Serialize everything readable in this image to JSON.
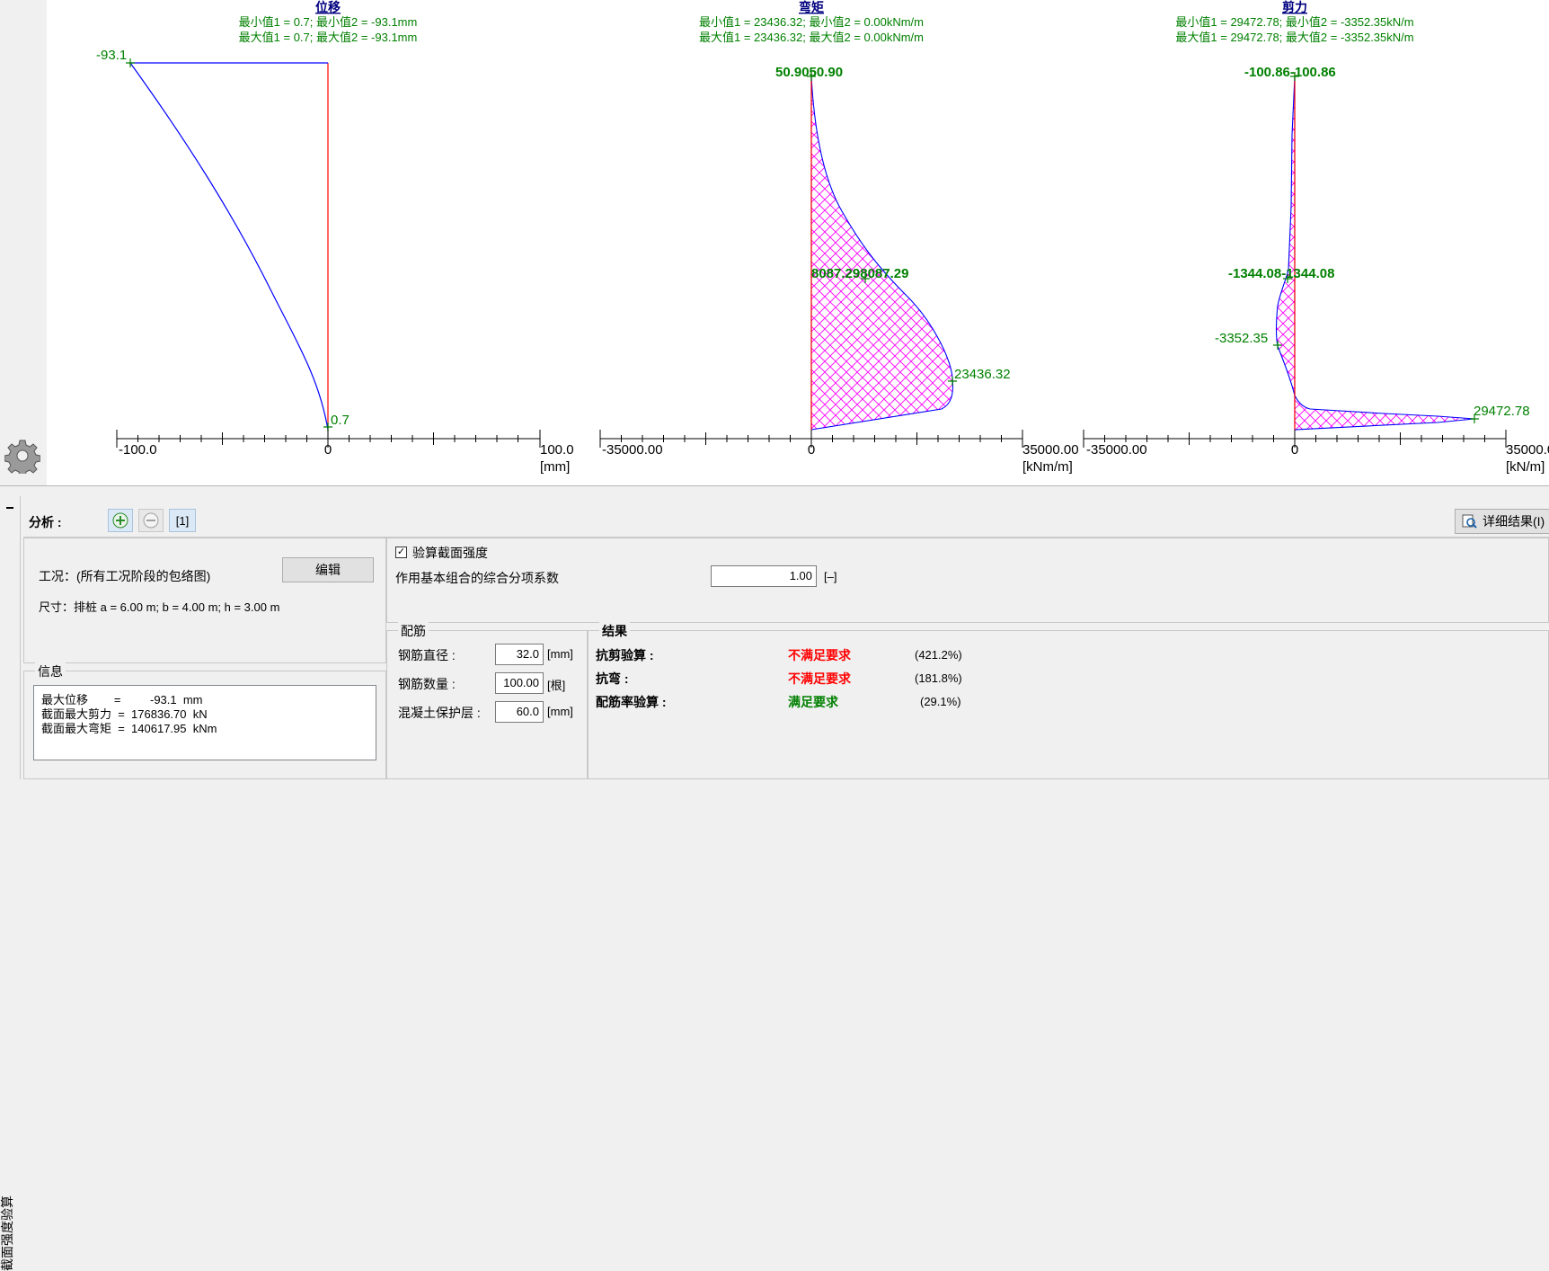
{
  "charts": {
    "displacement": {
      "title": "位移",
      "line1": "最小值1 = 0.7; 最小值2 = -93.1mm",
      "line2": "最大值1 = 0.7; 最大值2 = -93.1mm",
      "top_value": "-93.1",
      "bottom_value": "0.7",
      "axis_min": "-100.0",
      "axis_zero": "0",
      "axis_max": "100.0",
      "unit": "[mm]"
    },
    "moment": {
      "title": "弯矩",
      "line1": "最小值1 = 23436.32; 最小值2 = 0.00kNm/m",
      "line2": "最大值1 = 23436.32; 最大值2 = 0.00kNm/m",
      "top_value": "50.9050.90",
      "mid_value": "8087.298087.29",
      "peak_value": "23436.32",
      "axis_min": "-35000.00",
      "axis_zero": "0",
      "axis_max": "35000.00",
      "unit": "[kNm/m]"
    },
    "shear": {
      "title": "剪力",
      "line1": "最小值1 = 29472.78; 最小值2 = -3352.35kN/m",
      "line2": "最大值1 = 29472.78; 最大值2 = -3352.35kN/m",
      "top_value": "-100.86-100.86",
      "mid_value": "-1344.08-1344.08",
      "min_value": "-3352.35",
      "peak_value": "29472.78",
      "axis_min": "-35000.00",
      "axis_zero": "0",
      "axis_max": "35000.0",
      "unit": "[kN/m]"
    },
    "colors": {
      "curve": "#0000ff",
      "axis_red": "#ff0000",
      "label_green": "#008000",
      "title_blue": "#000080",
      "hatch": "#ff00ff"
    }
  },
  "analysis": {
    "label": "分析 :",
    "stage_tab": "[1]",
    "add_icon": "plus-icon",
    "remove_icon": "minus-icon",
    "detail_button": "详细结果(I)",
    "detail_icon": "magnifier-icon"
  },
  "left_panel": {
    "condition": "工况：(所有工况阶段的包络图)",
    "edit_button": "编辑",
    "size": "尺寸：排桩 a = 6.00 m; b = 4.00 m; h = 3.00 m"
  },
  "info": {
    "title": "信息",
    "rows": [
      "最大位移        =         -93.1  mm",
      "截面最大剪力  =  176836.70  kN",
      "截面最大弯矩  =  140617.95  kNm"
    ]
  },
  "check": {
    "checkbox_label": "验算截面强度",
    "checked": true,
    "factor_label": "作用基本组合的综合分项系数",
    "factor_value": "1.00",
    "factor_unit": "[–]"
  },
  "rebar": {
    "title": "配筋",
    "diameter_label": "钢筋直径 :",
    "diameter_value": "32.0",
    "diameter_unit": "[mm]",
    "count_label": "钢筋数量 :",
    "count_value": "100.00",
    "count_unit": "[根]",
    "cover_label": "混凝土保护层 :",
    "cover_value": "60.0",
    "cover_unit": "[mm]"
  },
  "results": {
    "title": "结果",
    "items": [
      {
        "label": "抗剪验算 :",
        "status": "不满足要求",
        "percent": "(421.2%)",
        "color": "#ff0000"
      },
      {
        "label": "抗弯 :",
        "status": "不满足要求",
        "percent": "(181.8%)",
        "color": "#ff0000"
      },
      {
        "label": "配筋率验算 :",
        "status": "满足要求",
        "percent": "(29.1%)",
        "color": "#008000"
      }
    ]
  },
  "side_tab": {
    "label": "截面强度验算"
  }
}
